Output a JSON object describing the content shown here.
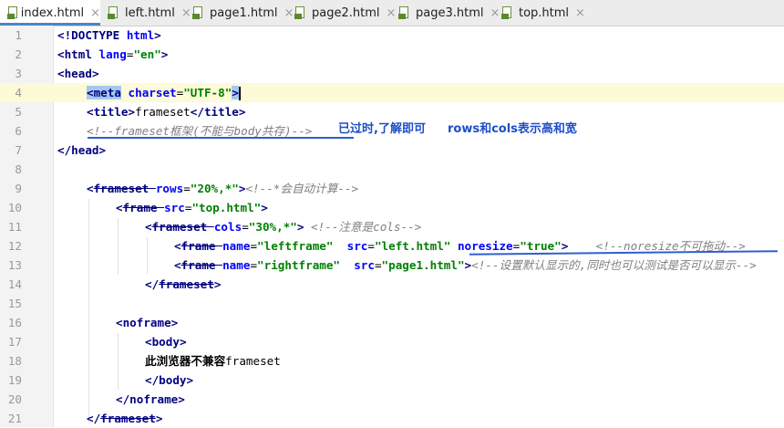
{
  "tabs": [
    {
      "label": "index.html",
      "active": true
    },
    {
      "label": "left.html",
      "active": false
    },
    {
      "label": "page1.html",
      "active": false
    },
    {
      "label": "page2.html",
      "active": false
    },
    {
      "label": "page3.html",
      "active": false
    },
    {
      "label": "top.html",
      "active": false
    }
  ],
  "tab_close_glyph": "×",
  "line_numbers": [
    "1",
    "2",
    "3",
    "4",
    "5",
    "6",
    "7",
    "8",
    "9",
    "10",
    "11",
    "12",
    "13",
    "14",
    "15",
    "16",
    "17",
    "18",
    "19",
    "20",
    "21"
  ],
  "code": {
    "l1": [
      "<!DOCTYPE ",
      "html",
      ">"
    ],
    "l2": [
      "<",
      "html ",
      "lang",
      "=",
      "\"en\"",
      ">"
    ],
    "l3": [
      "<",
      "head",
      ">"
    ],
    "l4": [
      "<",
      "meta",
      " ",
      "charset",
      "=",
      "\"UTF-8\"",
      ">"
    ],
    "l5": [
      "<",
      "title",
      ">",
      "frameset",
      "</",
      "title",
      ">"
    ],
    "l6": [
      "<!--frameset框架(不能与body共存)-->"
    ],
    "l7": [
      "</",
      "head",
      ">"
    ],
    "l9": [
      "<",
      "frameset ",
      "rows",
      "=",
      "\"20%,*\"",
      ">",
      "<!--*会自动计算-->"
    ],
    "l10": [
      "<",
      "frame ",
      "src",
      "=",
      "\"top.html\"",
      ">"
    ],
    "l11": [
      "<",
      "frameset ",
      "cols",
      "=",
      "\"30%,*\"",
      "> ",
      "<!--注意是cols-->"
    ],
    "l12": [
      "<",
      "frame ",
      "name",
      "=",
      "\"leftframe\"",
      "  ",
      "src",
      "=",
      "\"left.html\"",
      " ",
      "noresize",
      "=",
      "\"true\"",
      ">",
      "    ",
      "<!--noresize不可拖动-->"
    ],
    "l13": [
      "<",
      "frame ",
      "name",
      "=",
      "\"rightframe\"",
      "  ",
      "src",
      "=",
      "\"page1.html\"",
      ">",
      "<!--设置默认显示的,同时也可以测试是否可以显示-->"
    ],
    "l14": [
      "</",
      "frameset",
      ">"
    ],
    "l16": [
      "<",
      "noframe",
      ">"
    ],
    "l17": [
      "<",
      "body",
      ">"
    ],
    "l18": [
      "此浏览器不兼容",
      "frameset"
    ],
    "l19": [
      "</",
      "body",
      ">"
    ],
    "l20": [
      "</",
      "noframe",
      ">"
    ],
    "l21": [
      "</",
      "frameset",
      ">"
    ]
  },
  "annotations": {
    "a1": "已过时,了解即可",
    "a2": "rows和cols表示高和宽"
  },
  "colors": {
    "tag": "#000080",
    "attribute": "#0000ff",
    "string": "#008000",
    "comment": "#808080",
    "annotation": "#1e4fc8",
    "current_line": "#fcfad7",
    "file_icon": "#5b8a2a",
    "active_tab_underline": "#4a86c8"
  },
  "icons": {
    "tab_file": "html-file-icon",
    "tab_close": "close-icon"
  }
}
